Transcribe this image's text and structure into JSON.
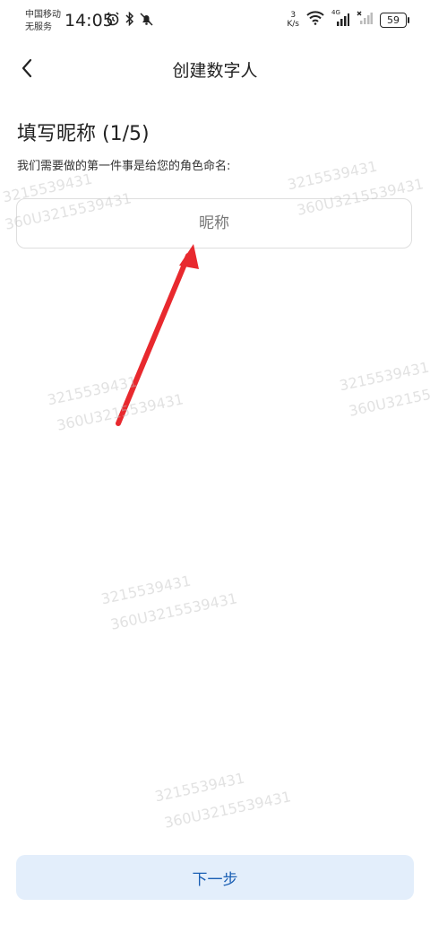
{
  "status_bar": {
    "carrier_line1": "中国移动",
    "carrier_line2": "无服务",
    "time": "14:05",
    "net_speed_value": "3",
    "net_speed_unit": "K/s",
    "cell_label": "4G",
    "battery": "59"
  },
  "nav": {
    "title": "创建数字人"
  },
  "form": {
    "section_title": "填写昵称 (1/5)",
    "description": "我们需要做的第一件事是给您的角色命名:",
    "nickname_placeholder": "昵称",
    "nickname_value": ""
  },
  "footer": {
    "next_label": "下一步"
  },
  "watermarks": {
    "id_short": "3215539431",
    "id_long": "360U3215539431"
  },
  "colors": {
    "accent": "#1a5fb4",
    "button_bg": "#e3eefb",
    "annotation_arrow": "#e8292e"
  }
}
